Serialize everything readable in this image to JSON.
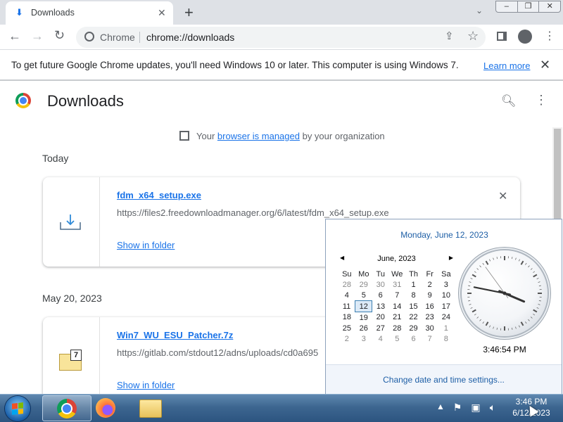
{
  "browser": {
    "tab_title": "Downloads",
    "address_origin": "Chrome",
    "address_url": "chrome://downloads",
    "window_buttons": [
      "–",
      "❐",
      "✕"
    ]
  },
  "infobar": {
    "message": "To get future Google Chrome updates, you'll need Windows 10 or later. This computer is using Windows 7.",
    "learn_more": "Learn more"
  },
  "page": {
    "title": "Downloads",
    "managed_prefix": "Your",
    "managed_link": "browser is managed",
    "managed_suffix": "by your organization"
  },
  "groups": [
    {
      "date": "Today",
      "items": [
        {
          "filename": "fdm_x64_setup.exe",
          "url": "https://files2.freedownloadmanager.org/6/latest/fdm_x64_setup.exe",
          "action": "Show in folder"
        }
      ]
    },
    {
      "date": "May 20, 2023",
      "items": [
        {
          "filename": "Win7_WU_ESU_Patcher.7z",
          "url": "https://gitlab.com/stdout12/adns/uploads/cd0a695",
          "action": "Show in folder"
        }
      ]
    }
  ],
  "clock_popup": {
    "long_date": "Monday, June 12, 2023",
    "month_label": "June, 2023",
    "weekdays": [
      "Su",
      "Mo",
      "Tu",
      "We",
      "Th",
      "Fr",
      "Sa"
    ],
    "weeks": [
      [
        "28",
        "29",
        "30",
        "31",
        "1",
        "2",
        "3"
      ],
      [
        "4",
        "5",
        "6",
        "7",
        "8",
        "9",
        "10"
      ],
      [
        "11",
        "12",
        "13",
        "14",
        "15",
        "16",
        "17"
      ],
      [
        "18",
        "19",
        "20",
        "21",
        "22",
        "23",
        "24"
      ],
      [
        "25",
        "26",
        "27",
        "28",
        "29",
        "30",
        "1"
      ],
      [
        "2",
        "3",
        "4",
        "5",
        "6",
        "7",
        "8"
      ]
    ],
    "selected_day": "12",
    "time": "3:46:54 PM",
    "settings_link": "Change date and time settings..."
  },
  "taskbar": {
    "time": "3:46 PM",
    "date": "6/12/2023"
  },
  "colors": {
    "link": "#1a73e8",
    "taskbar": "#3d6690",
    "popup_link": "#1e5fa6"
  }
}
